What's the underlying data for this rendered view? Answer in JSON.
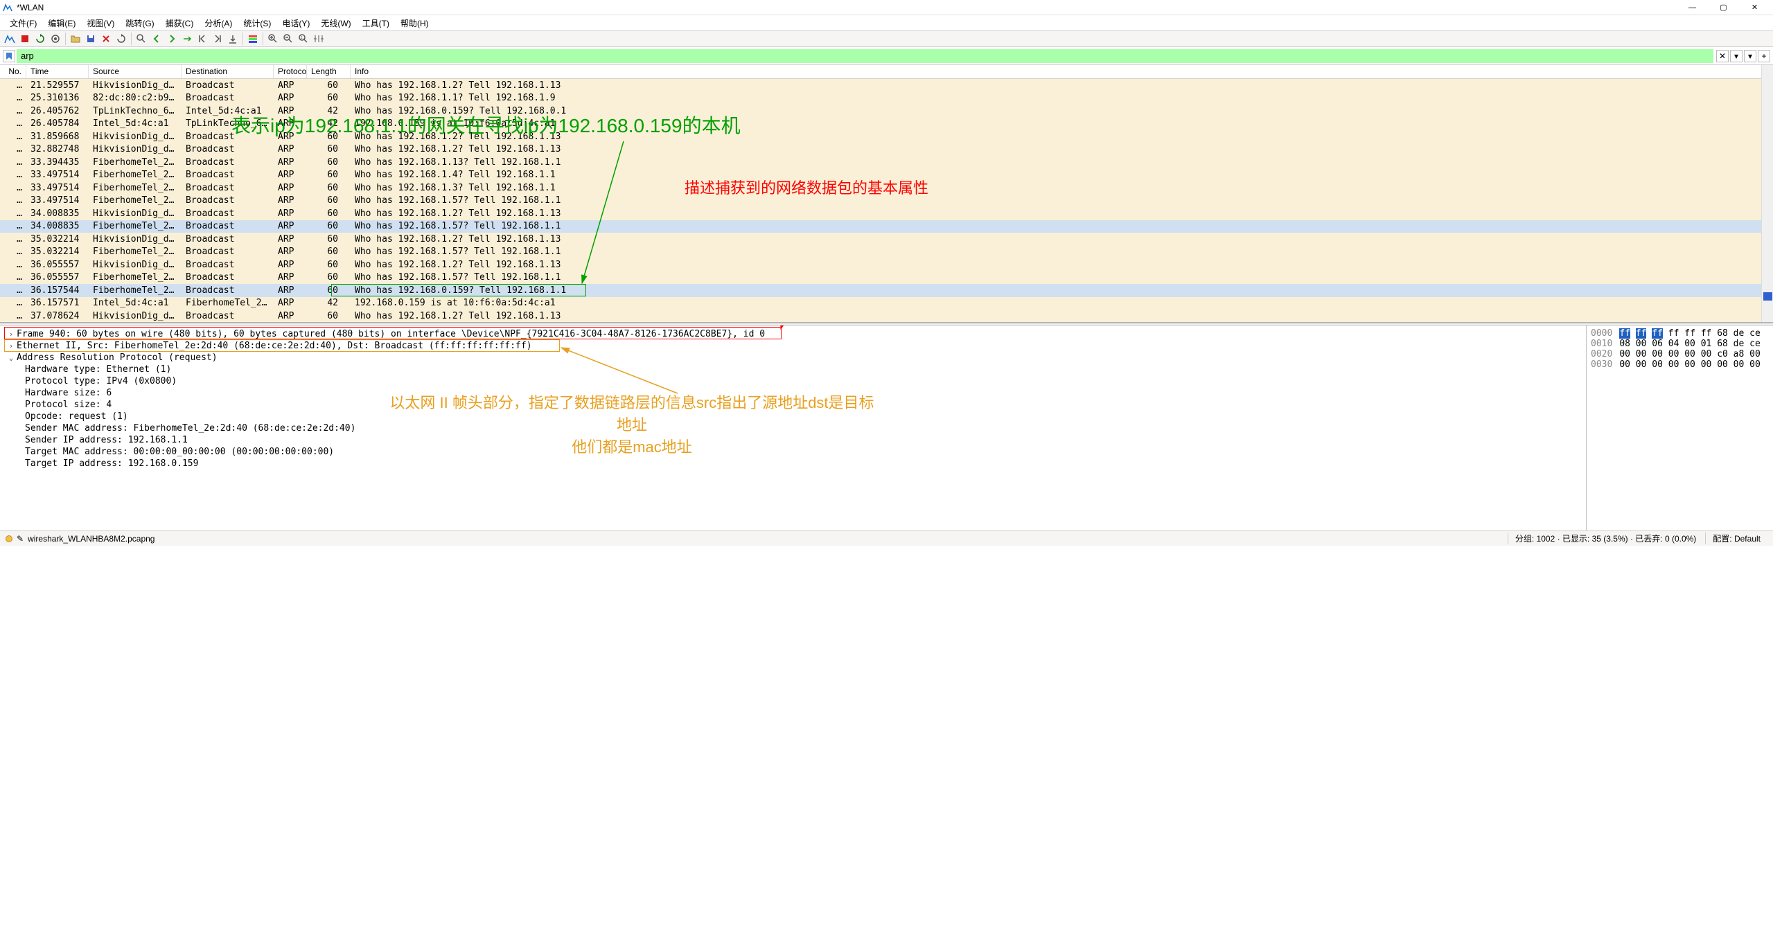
{
  "window": {
    "title": "*WLAN"
  },
  "menu": {
    "file": "文件(F)",
    "edit": "编辑(E)",
    "view": "视图(V)",
    "go": "跳转(G)",
    "capture": "捕获(C)",
    "analyze": "分析(A)",
    "stats": "统计(S)",
    "telephony": "电话(Y)",
    "wireless": "无线(W)",
    "tools": "工具(T)",
    "help": "帮助(H)"
  },
  "filter": {
    "value": "arp"
  },
  "columns": {
    "no": "No.",
    "time": "Time",
    "src": "Source",
    "dst": "Destination",
    "proto": "Protocol",
    "len": "Length",
    "info": "Info"
  },
  "packets": [
    {
      "no": "…",
      "time": "21.529557",
      "src": "HikvisionDig_da…",
      "dst": "Broadcast",
      "proto": "ARP",
      "len": "60",
      "info": "Who has 192.168.1.2? Tell 192.168.1.13"
    },
    {
      "no": "…",
      "time": "25.310136",
      "src": "82:dc:80:c2:b9:…",
      "dst": "Broadcast",
      "proto": "ARP",
      "len": "60",
      "info": "Who has 192.168.1.1? Tell 192.168.1.9"
    },
    {
      "no": "…",
      "time": "26.405762",
      "src": "TpLinkTechno_6a…",
      "dst": "Intel_5d:4c:a1",
      "proto": "ARP",
      "len": "42",
      "info": "Who has 192.168.0.159? Tell 192.168.0.1"
    },
    {
      "no": "…",
      "time": "26.405784",
      "src": "Intel_5d:4c:a1",
      "dst": "TpLinkTechno_6a…",
      "proto": "ARP",
      "len": "42",
      "info": "192.168.0.159 is at 10:f6:0a:5d:4c:a1"
    },
    {
      "no": "…",
      "time": "31.859668",
      "src": "HikvisionDig_da…",
      "dst": "Broadcast",
      "proto": "ARP",
      "len": "60",
      "info": "Who has 192.168.1.2? Tell 192.168.1.13"
    },
    {
      "no": "…",
      "time": "32.882748",
      "src": "HikvisionDig_da…",
      "dst": "Broadcast",
      "proto": "ARP",
      "len": "60",
      "info": "Who has 192.168.1.2? Tell 192.168.1.13"
    },
    {
      "no": "…",
      "time": "33.394435",
      "src": "FiberhomeTel_2e…",
      "dst": "Broadcast",
      "proto": "ARP",
      "len": "60",
      "info": "Who has 192.168.1.13? Tell 192.168.1.1"
    },
    {
      "no": "…",
      "time": "33.497514",
      "src": "FiberhomeTel_2e…",
      "dst": "Broadcast",
      "proto": "ARP",
      "len": "60",
      "info": "Who has 192.168.1.4? Tell 192.168.1.1"
    },
    {
      "no": "…",
      "time": "33.497514",
      "src": "FiberhomeTel_2e…",
      "dst": "Broadcast",
      "proto": "ARP",
      "len": "60",
      "info": "Who has 192.168.1.3? Tell 192.168.1.1"
    },
    {
      "no": "…",
      "time": "33.497514",
      "src": "FiberhomeTel_2e…",
      "dst": "Broadcast",
      "proto": "ARP",
      "len": "60",
      "info": "Who has 192.168.1.57? Tell 192.168.1.1"
    },
    {
      "no": "…",
      "time": "34.008835",
      "src": "HikvisionDig_da…",
      "dst": "Broadcast",
      "proto": "ARP",
      "len": "60",
      "info": "Who has 192.168.1.2? Tell 192.168.1.13"
    },
    {
      "no": "…",
      "time": "34.008835",
      "src": "FiberhomeTel_2e…",
      "dst": "Broadcast",
      "proto": "ARP",
      "len": "60",
      "info": "Who has 192.168.1.57? Tell 192.168.1.1",
      "sel": true
    },
    {
      "no": "…",
      "time": "35.032214",
      "src": "HikvisionDig_da…",
      "dst": "Broadcast",
      "proto": "ARP",
      "len": "60",
      "info": "Who has 192.168.1.2? Tell 192.168.1.13"
    },
    {
      "no": "…",
      "time": "35.032214",
      "src": "FiberhomeTel_2e…",
      "dst": "Broadcast",
      "proto": "ARP",
      "len": "60",
      "info": "Who has 192.168.1.57? Tell 192.168.1.1"
    },
    {
      "no": "…",
      "time": "36.055557",
      "src": "HikvisionDig_da…",
      "dst": "Broadcast",
      "proto": "ARP",
      "len": "60",
      "info": "Who has 192.168.1.2? Tell 192.168.1.13"
    },
    {
      "no": "…",
      "time": "36.055557",
      "src": "FiberhomeTel_2e…",
      "dst": "Broadcast",
      "proto": "ARP",
      "len": "60",
      "info": "Who has 192.168.1.57? Tell 192.168.1.1"
    },
    {
      "no": "…",
      "time": "36.157544",
      "src": "FiberhomeTel_2e…",
      "dst": "Broadcast",
      "proto": "ARP",
      "len": "60",
      "info": "Who has 192.168.0.159? Tell 192.168.1.1",
      "sel": true
    },
    {
      "no": "…",
      "time": "36.157571",
      "src": "Intel_5d:4c:a1",
      "dst": "FiberhomeTel_2e…",
      "proto": "ARP",
      "len": "42",
      "info": "192.168.0.159 is at 10:f6:0a:5d:4c:a1"
    },
    {
      "no": "…",
      "time": "37.078624",
      "src": "HikvisionDig_da…",
      "dst": "Broadcast",
      "proto": "ARP",
      "len": "60",
      "info": "Who has 192.168.1.2? Tell 192.168.1.13"
    }
  ],
  "details": {
    "frame": "Frame 940: 60 bytes on wire (480 bits), 60 bytes captured (480 bits) on interface \\Device\\NPF_{7921C416-3C04-48A7-8126-1736AC2C8BE7}, id 0",
    "eth": "Ethernet II, Src: FiberhomeTel_2e:2d:40 (68:de:ce:2e:2d:40), Dst: Broadcast (ff:ff:ff:ff:ff:ff)",
    "arp": "Address Resolution Protocol (request)",
    "arp_sub": [
      "Hardware type: Ethernet (1)",
      "Protocol type: IPv4 (0x0800)",
      "Hardware size: 6",
      "Protocol size: 4",
      "Opcode: request (1)",
      "Sender MAC address: FiberhomeTel_2e:2d:40 (68:de:ce:2e:2d:40)",
      "Sender IP address: 192.168.1.1",
      "Target MAC address: 00:00:00_00:00:00 (00:00:00:00:00:00)",
      "Target IP address: 192.168.0.159"
    ]
  },
  "hex": [
    {
      "off": "0000",
      "b": "ff ff ff ff ff ff 68 de  ce",
      "sel": 3
    },
    {
      "off": "0010",
      "b": "08 00 06 04 00 01 68 de  ce"
    },
    {
      "off": "0020",
      "b": "00 00 00 00 00 00 c0 a8  00"
    },
    {
      "off": "0030",
      "b": "00 00 00 00 00 00 00 00  00"
    }
  ],
  "statusbar": {
    "file": "wireshark_WLANHBA8M2.pcapng",
    "pkts": "分组: 1002 · 已显示: 35 (3.5%) · 已丢弃: 0 (0.0%)",
    "profile": "配置: Default"
  },
  "annotations": {
    "green_text": "表示ip为192.168.1.1的网关在寻找ip为192.168.0.159的本机",
    "red_text": "描述捕获到的网络数据包的基本属性",
    "orange_text1": "以太网 II 帧头部分，指定了数据链路层的信息src指出了源地址dst是目标地址",
    "orange_text2": "他们都是mac地址"
  }
}
